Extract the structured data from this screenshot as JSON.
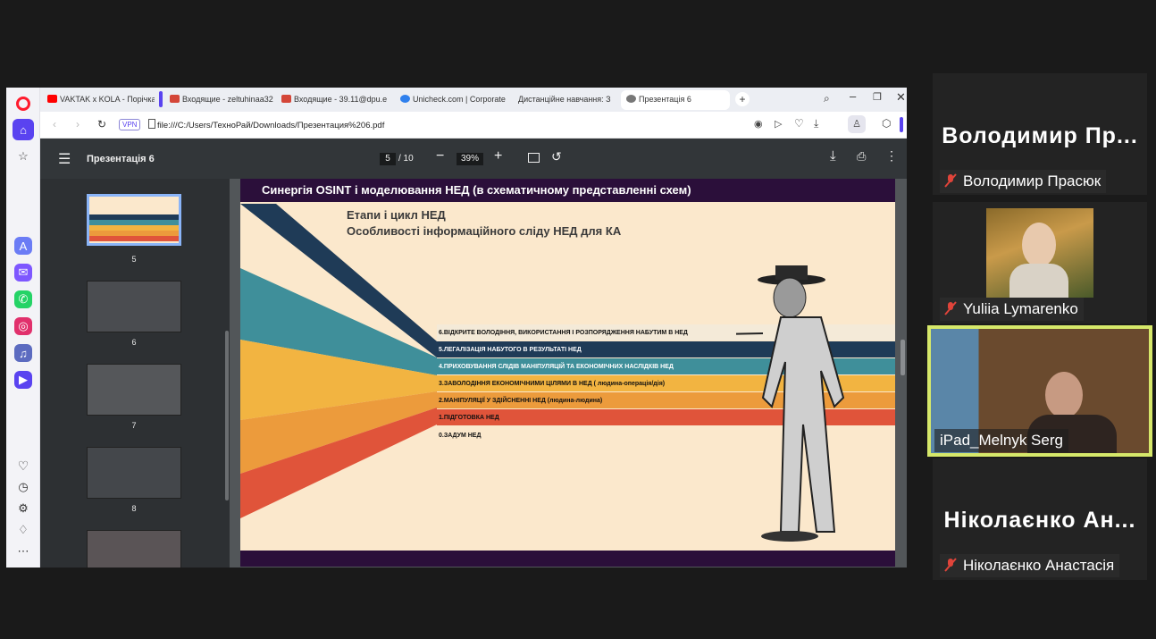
{
  "browser": {
    "tabs": [
      {
        "label": "VAKTAK x KOLA - Порічка",
        "color": "#ff0000"
      },
      {
        "label": "Входящие - zeltuhinaa32",
        "color": "#d44638"
      },
      {
        "label": "Входящие - 39.11@dpu.e",
        "color": "#d44638"
      },
      {
        "label": "Unicheck.com | Corporate",
        "color": "#2f80ed"
      },
      {
        "label": "Дистанційне навчання: З",
        "color": ""
      },
      {
        "label": "Презентація 6",
        "color": "#555555"
      }
    ],
    "vpn_label": "VPN",
    "url": "file:///C:/Users/ТехноРай/Downloads/Презентация%206.pdf",
    "sidebar_icons": [
      "opera-logo",
      "home-icon",
      "star-icon",
      "aria-icon",
      "messenger-icon",
      "whatsapp-icon",
      "instagram-icon",
      "music-icon",
      "player-icon",
      "heart-icon",
      "history-icon",
      "settings-icon",
      "bulb-icon",
      "more-icon"
    ]
  },
  "pdf": {
    "title": "Презентація 6",
    "current_page": "5",
    "total_pages": "/ 10",
    "zoom": "39%",
    "thumbnails": [
      "5",
      "6",
      "7",
      "8"
    ]
  },
  "slide": {
    "title": "Синергія OSINT і моделювання НЕД (в схематичному представленні схем)",
    "heading1": "Етапи і цикл НЕД",
    "heading2": "Особливості інформаційного сліду НЕД для КА",
    "stages": [
      {
        "label": "6.ВІДКРИТЕ ВОЛОДІННЯ, ВИКОРИСТАННЯ І РОЗПОРЯДЖЕННЯ НАБУТИМ В НЕД",
        "color": "#f4ead8",
        "text": "#111111"
      },
      {
        "label": "5.ЛЕГАЛІЗАЦІЯ НАБУТОГО В РЕЗУЛЬТАТІ НЕД",
        "color": "#1f3b57",
        "text": "#ffffff"
      },
      {
        "label": "4.ПРИХОВУВАННЯ СЛІДІВ МАНІПУЛЯЦІЙ ТА ЕКОНОМІЧНИХ НАСЛІДКІВ НЕД",
        "color": "#3f8f9a",
        "text": "#ffffff"
      },
      {
        "label": "3.ЗАВОЛОДІННЯ ЕКОНОМІЧНИМИ ЦІЛЯМИ В НЕД ( людина-операція/дія)",
        "color": "#f2b441",
        "text": "#111111"
      },
      {
        "label": "2.МАНІПУЛЯЦІЇ У ЗДІЙСНЕННІ НЕД (людина-людина)",
        "color": "#ec9b3c",
        "text": "#111111"
      },
      {
        "label": "1.ПІДГОТОВКА НЕД",
        "color": "#e0543a",
        "text": "#111111"
      },
      {
        "label": "0.ЗАДУМ НЕД",
        "color": "#fbe8cc",
        "text": "#111111"
      }
    ]
  },
  "participants": [
    {
      "big": "Володимир Пр...",
      "name": "Володимир Прасюк"
    },
    {
      "name": "Yuliia Lymarenko"
    },
    {
      "name": "iPad_Melnyk Serg"
    },
    {
      "big": "Ніколаєнко Ан...",
      "name": "Ніколаєнко Анастасія"
    }
  ],
  "colors": {
    "speaker_border": "#d6e86a",
    "slide_purple": "#2b0f3a",
    "muted_red": "#e0443a"
  }
}
